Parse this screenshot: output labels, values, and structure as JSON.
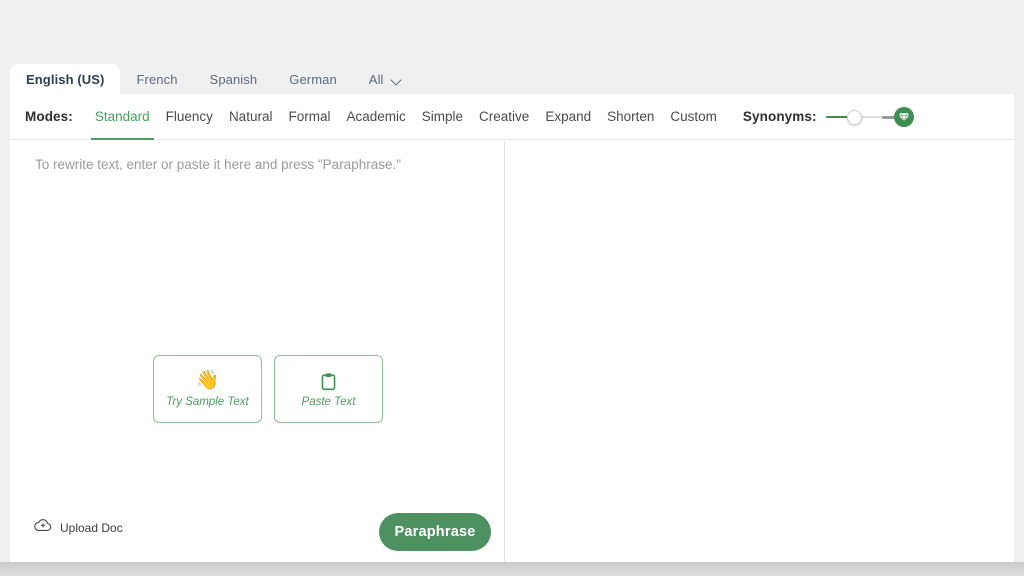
{
  "theme": {
    "page_background": "#f0f0f0",
    "accent_green": "#4d9160",
    "mode_active_green": "#49a05f",
    "muted_text": "#9b9b9b",
    "tab_text": "#5b6b7c"
  },
  "language_tabs": {
    "items": [
      {
        "label": "English (US)",
        "active": true
      },
      {
        "label": "French",
        "active": false
      },
      {
        "label": "Spanish",
        "active": false
      },
      {
        "label": "German",
        "active": false
      },
      {
        "label": "All",
        "active": false,
        "icon": "chevron-down-icon"
      }
    ]
  },
  "toolbar": {
    "modes_label": "Modes:",
    "modes": [
      {
        "label": "Standard",
        "active": true
      },
      {
        "label": "Fluency",
        "active": false
      },
      {
        "label": "Natural",
        "active": false
      },
      {
        "label": "Formal",
        "active": false
      },
      {
        "label": "Academic",
        "active": false
      },
      {
        "label": "Simple",
        "active": false
      },
      {
        "label": "Creative",
        "active": false
      },
      {
        "label": "Expand",
        "active": false
      },
      {
        "label": "Shorten",
        "active": false
      },
      {
        "label": "Custom",
        "active": false
      }
    ],
    "synonyms_label": "Synonyms:",
    "synonyms_value": 30,
    "synonyms_min": 0,
    "synonyms_max": 100,
    "synonyms_premium_icon": "diamond-icon"
  },
  "editor": {
    "placeholder": "To rewrite text, enter or paste it here and press \"Paraphrase.\"",
    "value": "",
    "quick_actions": [
      {
        "label": "Try Sample Text",
        "icon": "waving-hand-icon",
        "glyph": "👋"
      },
      {
        "label": "Paste Text",
        "icon": "clipboard-icon",
        "glyph": ""
      }
    ]
  },
  "bottom_bar": {
    "upload_label": "Upload Doc",
    "upload_icon": "cloud-upload-icon",
    "paraphrase_label": "Paraphrase"
  },
  "output_pane": {
    "text": ""
  }
}
